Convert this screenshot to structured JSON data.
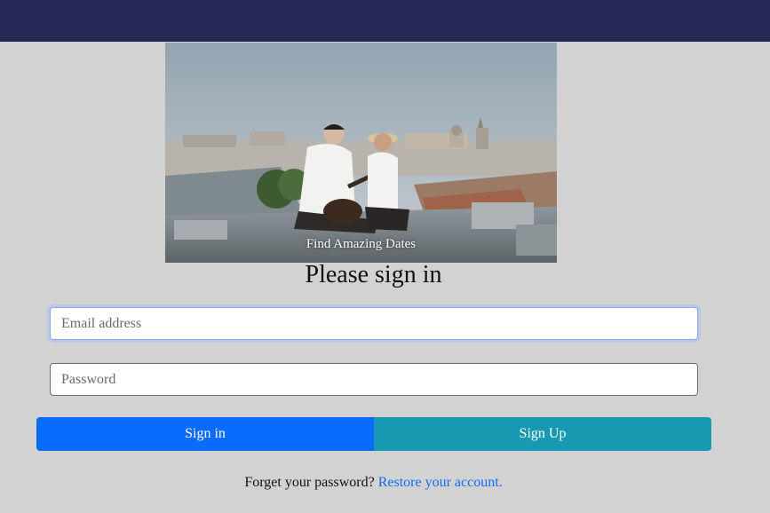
{
  "hero": {
    "caption": "Find Amazing Dates",
    "image_icon": "couple-on-rooftop-photo"
  },
  "form": {
    "title": "Please sign in",
    "email_placeholder": "Email address",
    "password_placeholder": "Password",
    "signin_label": "Sign in",
    "signup_label": "Sign Up",
    "forgot_text": "Forget your password?",
    "restore_link": "Restore your account."
  },
  "colors": {
    "topbar": "#272a55",
    "background": "#d3d2d2",
    "signin": "#0a6cfe",
    "signup": "#1699b1",
    "link": "#0b6ef0"
  }
}
